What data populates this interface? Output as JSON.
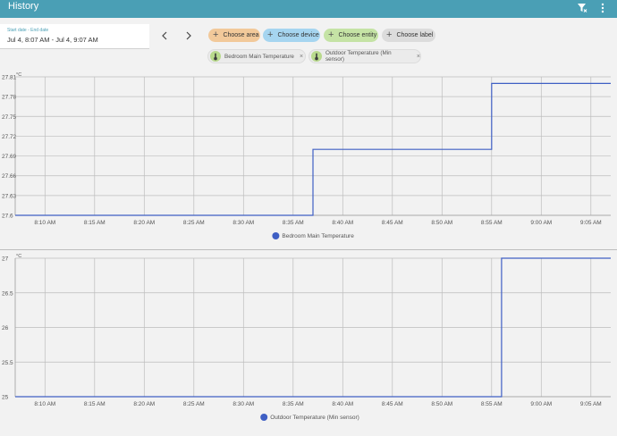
{
  "header": {
    "title": "History"
  },
  "date": {
    "label": "Start date - End date",
    "value": "Jul 4, 8:07 AM - Jul 4, 9:07 AM"
  },
  "targets": [
    {
      "label": "Choose area",
      "color": "#f2c99a"
    },
    {
      "label": "Choose device",
      "color": "#a6d5f0"
    },
    {
      "label": "Choose entity",
      "color": "#c5e3a5"
    },
    {
      "label": "Choose label",
      "color": "#dcdcdc"
    }
  ],
  "entities": [
    "Bedroom Main Temperature",
    "Outdoor Temperature (Min sensor)"
  ],
  "line_color": "#3f5fc4",
  "chart_data": [
    {
      "type": "line",
      "unit": "°C",
      "x_ticks": [
        "8:10 AM",
        "8:15 AM",
        "8:20 AM",
        "8:25 AM",
        "8:30 AM",
        "8:35 AM",
        "8:40 AM",
        "8:45 AM",
        "8:50 AM",
        "8:55 AM",
        "9:00 AM",
        "9:05 AM"
      ],
      "y_ticks": [
        "27.6",
        "27.63",
        "27.66",
        "27.69",
        "27.72",
        "27.75",
        "27.78",
        "27.81"
      ],
      "ylim": [
        27.6,
        27.81
      ],
      "xlim": [
        "8:07 AM",
        "9:07 AM"
      ],
      "legend": "Bedroom Main Temperature",
      "series": [
        {
          "name": "Bedroom Main Temperature",
          "x": [
            "8:07 AM",
            "8:37 AM",
            "8:37 AM",
            "8:55 AM",
            "8:55 AM",
            "9:07 AM"
          ],
          "y": [
            27.6,
            27.6,
            27.7,
            27.7,
            27.8,
            27.8
          ]
        }
      ]
    },
    {
      "type": "line",
      "unit": "°C",
      "x_ticks": [
        "8:10 AM",
        "8:15 AM",
        "8:20 AM",
        "8:25 AM",
        "8:30 AM",
        "8:35 AM",
        "8:40 AM",
        "8:45 AM",
        "8:50 AM",
        "8:55 AM",
        "9:00 AM",
        "9:05 AM"
      ],
      "y_ticks": [
        "25",
        "25.5",
        "26",
        "26.5",
        "27"
      ],
      "ylim": [
        25,
        27
      ],
      "xlim": [
        "8:07 AM",
        "9:07 AM"
      ],
      "legend": "Outdoor Temperature (Min sensor)",
      "series": [
        {
          "name": "Outdoor Temperature (Min sensor)",
          "x": [
            "8:07 AM",
            "8:56 AM",
            "8:56 AM",
            "9:07 AM"
          ],
          "y": [
            25,
            25,
            27,
            27
          ]
        }
      ]
    }
  ]
}
